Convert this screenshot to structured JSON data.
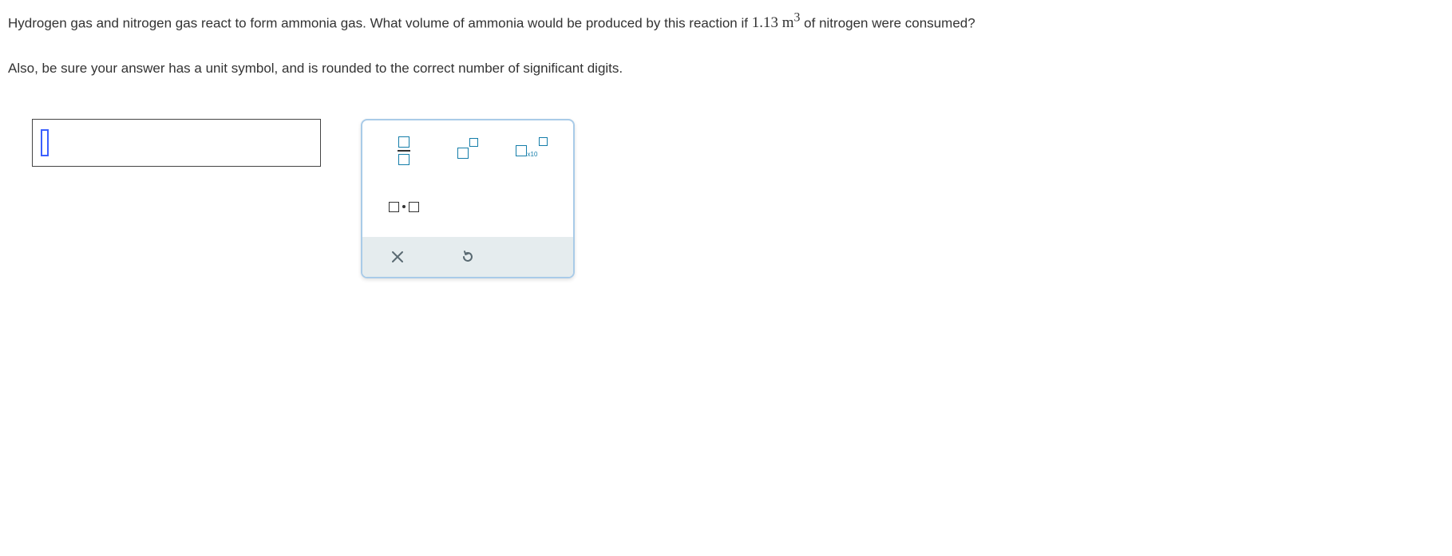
{
  "question": {
    "part1": "Hydrogen gas and nitrogen gas react to form ammonia gas. What volume of ammonia would be produced by this reaction if ",
    "value": "1.13",
    "unit_base": "m",
    "unit_exp": "3",
    "part2": " of nitrogen were consumed?",
    "part3": "Also, be sure your answer has a unit symbol, and is rounded to the correct number of significant digits."
  },
  "palette": {
    "sci_sub": "x10"
  }
}
